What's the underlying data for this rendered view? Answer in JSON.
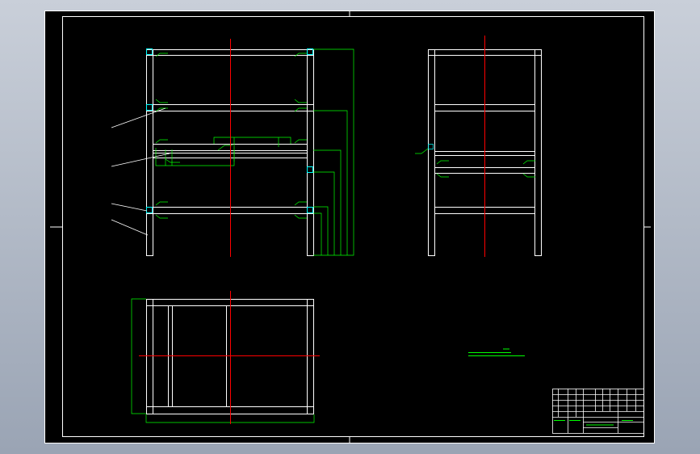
{
  "colors": {
    "background": "#000000",
    "outline": "#ffffff",
    "centerline": "#ff0000",
    "dimension": "#00ff00",
    "joint": "#00ffff",
    "viewport": "#aab3c2"
  },
  "drawing": {
    "views": [
      "front-view",
      "side-view",
      "top-view"
    ],
    "leader_count": 4
  }
}
